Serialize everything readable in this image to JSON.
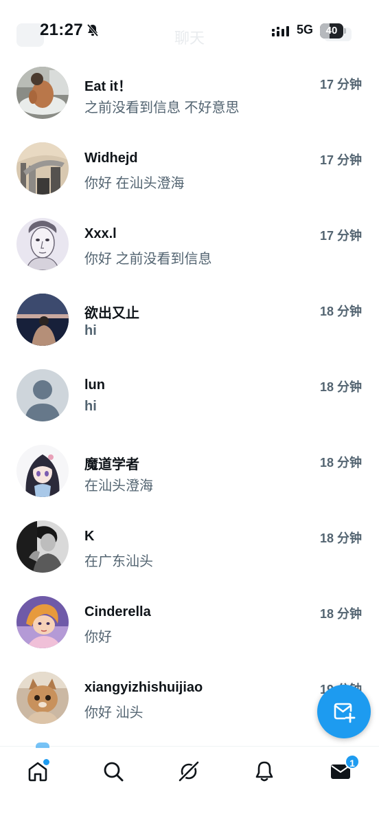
{
  "status_bar": {
    "time": "21:27",
    "network": "5G",
    "battery_level": "40",
    "battery_fraction": 0.4
  },
  "header": {
    "title": "聊天"
  },
  "conversations": [
    {
      "name": "Eat it！",
      "time_ago": "17 分钟",
      "preview": "之前没看到信息 不好意思",
      "preview_bold": false
    },
    {
      "name": "Widhejd",
      "time_ago": "17 分钟",
      "preview": "你好 在汕头澄海",
      "preview_bold": false
    },
    {
      "name": "Xxx.l",
      "time_ago": "17 分钟",
      "preview": "你好 之前没看到信息",
      "preview_bold": false
    },
    {
      "name": "欲出又止",
      "time_ago": "18 分钟",
      "preview": "hi",
      "preview_bold": true
    },
    {
      "name": "lun",
      "time_ago": "18 分钟",
      "preview": "hi",
      "preview_bold": true
    },
    {
      "name": "魔道学者",
      "time_ago": "18 分钟",
      "preview": "在汕头澄海",
      "preview_bold": false
    },
    {
      "name": "K",
      "time_ago": "18 分钟",
      "preview": "在广东汕头",
      "preview_bold": false
    },
    {
      "name": "Cinderella",
      "time_ago": "18 分钟",
      "preview": "你好",
      "preview_bold": false
    },
    {
      "name": "xiangyizhishuijiao",
      "time_ago": "19 分钟",
      "preview": "你好 汕头",
      "preview_bold": false
    }
  ],
  "bottom_nav": {
    "messages_badge": "1",
    "icons": [
      "home-icon",
      "search-icon",
      "grok-icon",
      "bell-icon",
      "mail-icon"
    ]
  },
  "colors": {
    "accent": "#1d9bf0",
    "text_primary": "#0f1419",
    "text_secondary": "#536471"
  }
}
